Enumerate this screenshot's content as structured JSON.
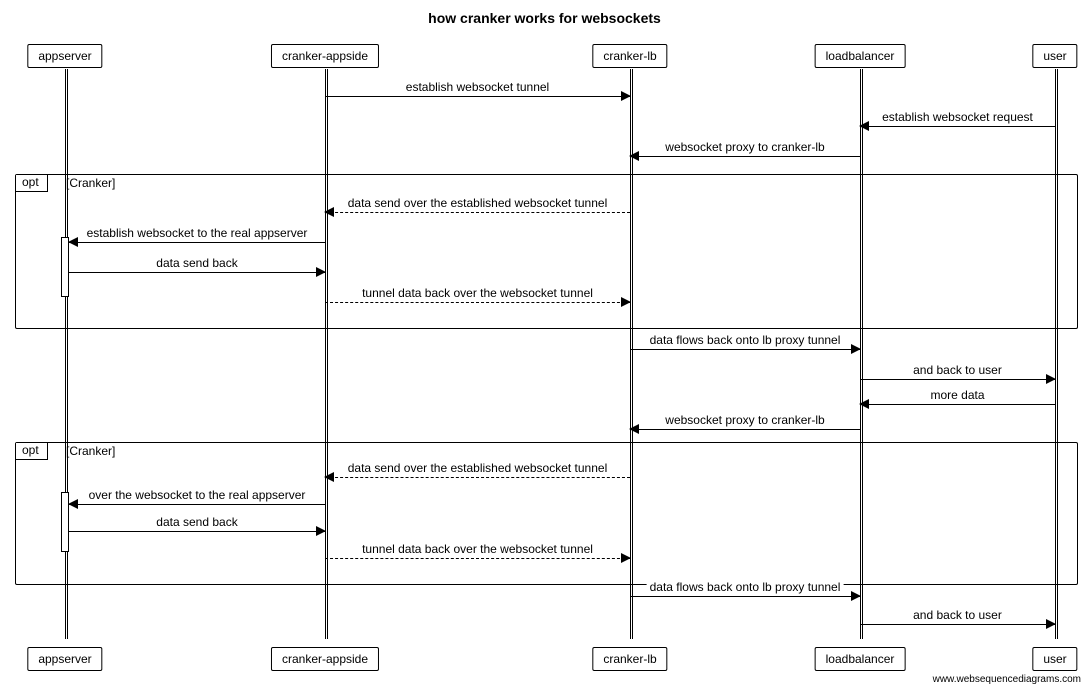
{
  "title": "how cranker works for websockets",
  "actors": {
    "appserver": "appserver",
    "cranker_appside": "cranker-appside",
    "cranker_lb": "cranker-lb",
    "loadbalancer": "loadbalancer",
    "user": "user"
  },
  "opt": {
    "label": "opt",
    "condition": "[Cranker]"
  },
  "messages": {
    "m1": "establish websocket tunnel",
    "m2": "establish websocket request",
    "m3": "websocket proxy to cranker-lb",
    "m4": "data send over the established websocket tunnel",
    "m5": "establish websocket to the real appserver",
    "m6": "data send back",
    "m7": "tunnel data back over the websocket tunnel",
    "m8": "data flows back onto lb proxy tunnel",
    "m9": "and back to user",
    "m10": "more data",
    "m11": "websocket proxy to cranker-lb",
    "m12": "data send over the established websocket tunnel",
    "m13": "over the websocket to the real appserver",
    "m14": "data send back",
    "m15": "tunnel data back over the websocket tunnel",
    "m16": "data flows back onto lb proxy tunnel",
    "m17": "and back to user"
  },
  "credit": "www.websequencediagrams.com"
}
